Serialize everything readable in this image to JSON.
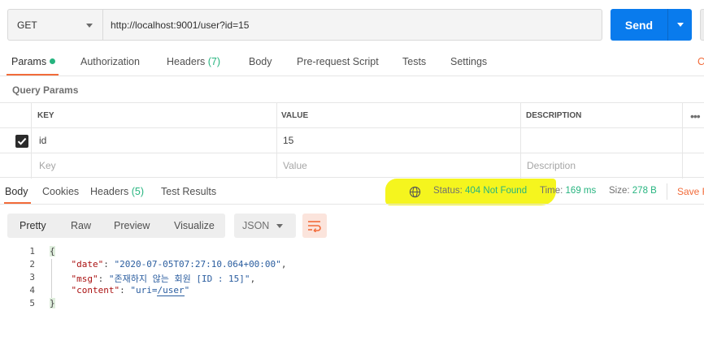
{
  "request": {
    "method": "GET",
    "url": "http://localhost:9001/user?id=15",
    "send_label": "Send"
  },
  "request_tabs": [
    {
      "label": "Params",
      "count": "",
      "active": true,
      "dot": true
    },
    {
      "label": "Authorization",
      "count": ""
    },
    {
      "label": "Headers",
      "count": "(7)"
    },
    {
      "label": "Body",
      "count": ""
    },
    {
      "label": "Pre-request Script",
      "count": ""
    },
    {
      "label": "Tests",
      "count": ""
    },
    {
      "label": "Settings",
      "count": ""
    },
    {
      "label": "C",
      "count": ""
    }
  ],
  "query_params": {
    "title": "Query Params",
    "columns": [
      "KEY",
      "VALUE",
      "DESCRIPTION"
    ],
    "rows": [
      {
        "checked": true,
        "key": "id",
        "value": "15",
        "description": ""
      }
    ],
    "placeholder": {
      "key": "Key",
      "value": "Value",
      "description": "Description"
    },
    "more_icon": "ellipsis-icon"
  },
  "response_tabs": [
    {
      "label": "Body",
      "count": "",
      "active": true
    },
    {
      "label": "Cookies",
      "count": ""
    },
    {
      "label": "Headers",
      "count": "(5)"
    },
    {
      "label": "Test Results",
      "count": ""
    }
  ],
  "response_meta": {
    "status_label": "Status:",
    "status_value": "404 Not Found",
    "time_label": "Time:",
    "time_value": "169 ms",
    "size_label": "Size:",
    "size_value": "278 B",
    "save_label": "Save R",
    "highlight_color": "#f5f51e"
  },
  "view_modes": [
    "Pretty",
    "Raw",
    "Preview",
    "Visualize"
  ],
  "format": "JSON",
  "line_numbers": [
    "1",
    "2",
    "3",
    "4",
    "5"
  ],
  "body": {
    "open_brace": "{",
    "close_brace": "}",
    "fields": [
      {
        "key": "\"date\"",
        "value": "\"2020-07-05T07:27:10.064+00:00\""
      },
      {
        "key": "\"msg\"",
        "value": "\"존재하지 않는 회원 [ID : 15]\""
      },
      {
        "key": "\"content\"",
        "value_prefix": "\"uri=",
        "value_link": "/user",
        "value_suffix": "\""
      }
    ]
  },
  "colors": {
    "accent_orange": "#f26b3a",
    "send_blue": "#097bed",
    "success_green": "#26b47f"
  }
}
